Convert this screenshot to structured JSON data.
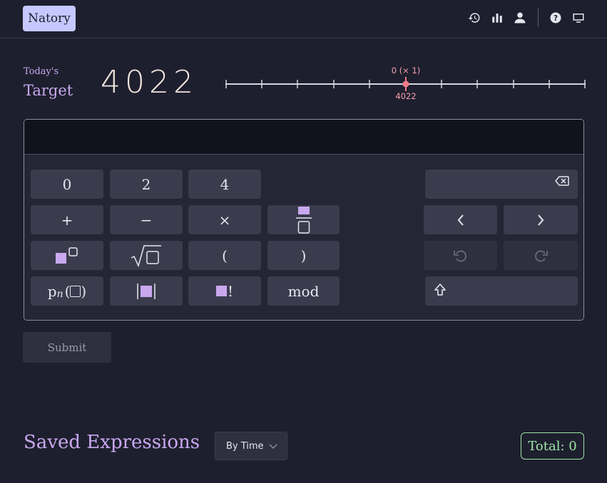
{
  "header": {
    "logo_text": "Natory",
    "icons": [
      "history-icon",
      "stats-icon",
      "user-icon",
      "help-icon",
      "monitor-icon"
    ]
  },
  "target": {
    "today_label": "Today's",
    "target_label": "Target",
    "number": "4022",
    "slider_top_label": "0 (× 1)",
    "slider_bottom_label": "4022"
  },
  "keypad": {
    "digits": [
      "0",
      "2",
      "4"
    ],
    "plus": "+",
    "minus": "−",
    "times": "×",
    "open_paren": "(",
    "close_paren": ")",
    "factorial": "!",
    "mod": "mod",
    "pn_p": "p",
    "pn_n": "n"
  },
  "submit_label": "Submit",
  "saved": {
    "title": "Saved Expressions",
    "sort_value": "By Time",
    "total_label": "Total: 0"
  },
  "colors": {
    "accent_purple": "#c9a8f0",
    "logo_bg": "#c6c8ff",
    "total_green": "#9ee6a8",
    "slider_pink": "#f07a8a"
  }
}
